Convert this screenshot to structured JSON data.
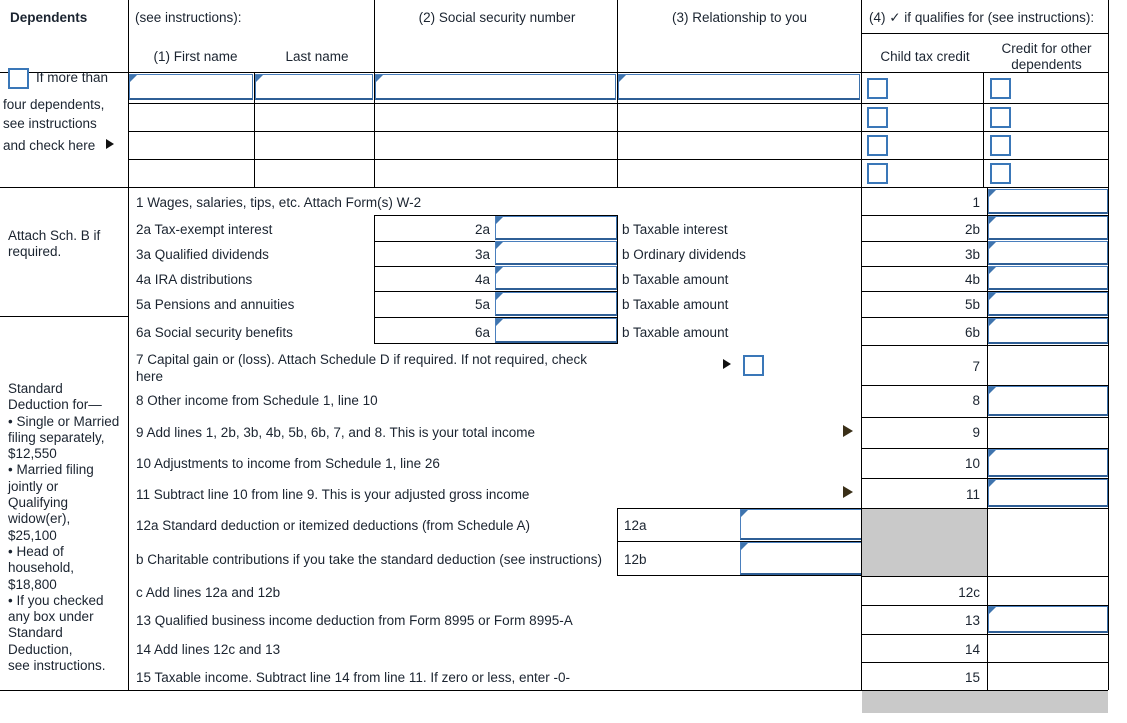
{
  "form": {
    "dependents_header": "Dependents",
    "more_than_four_note_lines": [
      "If more than",
      "four dependents,",
      "see instructions",
      "and check here"
    ],
    "see_instructions": "(see instructions):",
    "col_first_name": "(1) First name",
    "col_last_name": "Last name",
    "col_ssn": "(2) Social security number",
    "col_relationship": "(3) Relationship to you",
    "col_qualifies": "(4) ✓ if qualifies for (see instructions):",
    "col_child_tax_credit": "Child tax credit",
    "col_credit_other_dependents_line1": "Credit for other",
    "col_credit_other_dependents_line2": "dependents",
    "attach_sch_b_line1": "Attach Sch. B if",
    "attach_sch_b_line2": "required.",
    "standard_deduction_lines": [
      "Standard",
      "Deduction for—",
      "• Single or Married",
      "filing separately,",
      "$12,550",
      "• Married filing",
      "jointly or",
      "Qualifying",
      "widow(er),",
      "$25,100",
      "• Head of",
      "household,",
      "$18,800",
      "• If you checked",
      "any box under",
      "Standard",
      "Deduction,",
      "see instructions."
    ]
  },
  "lines": {
    "l1": "1 Wages, salaries, tips, etc. Attach Form(s) W-2",
    "l2a": "2a Tax-exempt interest",
    "l2a_num": "2a",
    "l2b": "b Taxable interest",
    "l2b_num": "2b",
    "l3a": "3a Qualified dividends",
    "l3a_num": "3a",
    "l3b": "b Ordinary dividends",
    "l3b_num": "3b",
    "l4a": "4a IRA distributions",
    "l4a_num": "4a",
    "l4b": "b Taxable amount",
    "l4b_num": "4b",
    "l5a": "5a Pensions and annuities",
    "l5a_num": "5a",
    "l5b": "b Taxable amount",
    "l5b_num": "5b",
    "l6a": "6a Social security benefits",
    "l6a_num": "6a",
    "l6b": "b Taxable amount",
    "l6b_num": "6b",
    "l1_num": "1",
    "l7_a": "7 Capital gain or (loss). Attach Schedule D if required. If not required, check",
    "l7_b": "here",
    "l7_num": "7",
    "l8": "8 Other income from Schedule 1, line 10",
    "l8_num": "8",
    "l9": "9 Add lines 1, 2b, 3b, 4b, 5b, 6b, 7, and 8. This is your total income",
    "l9_num": "9",
    "l10": "10 Adjustments to income from Schedule 1, line 26",
    "l10_num": "10",
    "l11": "11 Subtract line 10 from line 9. This is your adjusted gross income",
    "l11_num": "11",
    "l12a": "12a Standard deduction or itemized deductions (from Schedule A)",
    "l12a_num": "12a",
    "l12b": "b Charitable contributions if you take the standard deduction (see instructions)",
    "l12b_num": "12b",
    "l12c": "c Add lines 12a and 12b",
    "l12c_num": "12c",
    "l13": "13 Qualified business income deduction from Form 8995 or Form 8995-A",
    "l13_num": "13",
    "l14": "14 Add lines 12c and 13",
    "l14_num": "14",
    "l15": "15 Taxable income. Subtract line 14 from line 11. If zero or less, enter -0-",
    "l15_num": "15"
  },
  "values": {
    "dep1_first": "",
    "dep1_last": "",
    "dep1_ssn": "",
    "dep1_rel": "",
    "l1_amt": "",
    "l2a_amt": "",
    "l2b_amt": "",
    "l3a_amt": "",
    "l3b_amt": "",
    "l4a_amt": "",
    "l4b_amt": "",
    "l5a_amt": "",
    "l5b_amt": "",
    "l6a_amt": "",
    "l6b_amt": "",
    "l8_amt": "",
    "l10_amt": "",
    "l11_amt": "",
    "l12a_amt": "",
    "l12b_amt": "",
    "l13_amt": ""
  },
  "colors": {
    "field_border": "#4a7fbd",
    "checkbox_border": "#3a77b8",
    "rule": "#000000",
    "shaded": "#c9c9c9",
    "text": "#1b2430"
  }
}
